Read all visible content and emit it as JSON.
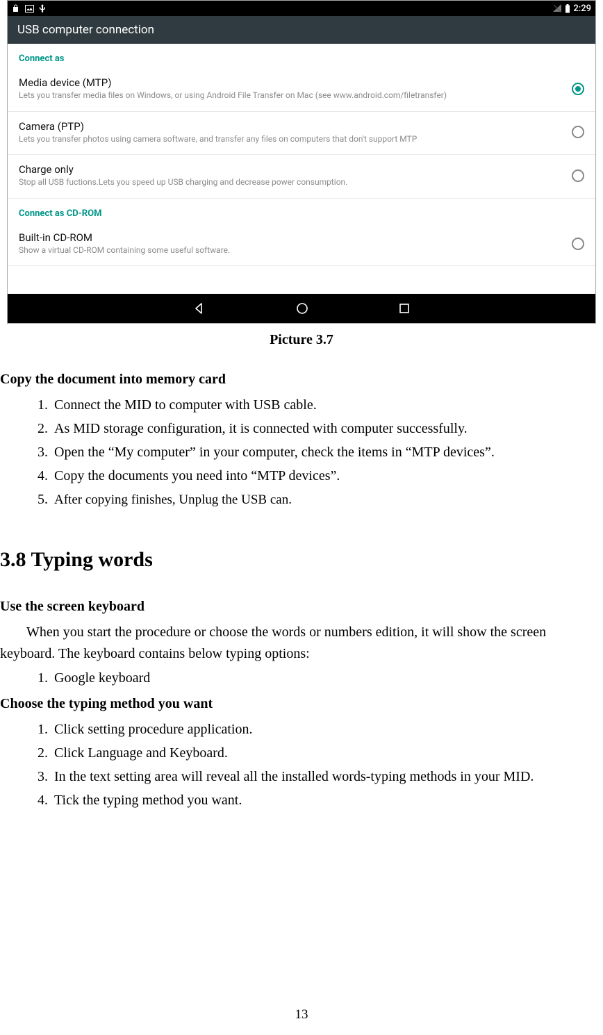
{
  "screenshot": {
    "statusbar": {
      "time": "2:29"
    },
    "title": "USB computer connection",
    "section1": "Connect as",
    "options": [
      {
        "title": "Media device (MTP)",
        "sub": "Lets you transfer media files on Windows, or using Android File Transfer on Mac (see www.android.com/filetransfer)",
        "selected": true
      },
      {
        "title": "Camera (PTP)",
        "sub": "Lets you transfer photos using camera software, and transfer any files on computers that don't support MTP",
        "selected": false
      },
      {
        "title": "Charge only",
        "sub": "Stop all USB fuctions.Lets you speed up USB charging and decrease power consumption.",
        "selected": false
      }
    ],
    "section2": "Connect as CD-ROM",
    "option_cd": {
      "title": "Built-in CD-ROM",
      "sub": "Show a virtual CD-ROM containing some useful software.",
      "selected": false
    }
  },
  "caption": "Picture 3.7",
  "copy_section": {
    "heading": "Copy the document into memory card",
    "items": [
      "Connect the MID to computer with USB cable.",
      "As MID storage configuration, it is connected with computer successfully.",
      "Open the “My computer” in your computer, check the items in “MTP devices”.",
      "Copy the documents you need into “MTP devices”.",
      "After copying finishes, Unplug the USB can."
    ]
  },
  "typing_section": {
    "heading": "3.8 Typing words",
    "sub1": "Use the screen keyboard",
    "para": "When you start the procedure or choose the words or numbers edition, it will show the screen keyboard. The keyboard contains below typing options:",
    "kb_items": [
      "Google keyboard"
    ],
    "sub2": "Choose the typing method you want",
    "steps": [
      "Click setting procedure application.",
      "Click Language and Keyboard.",
      "In the text setting area will reveal all the installed words-typing methods in your MID.",
      "Tick the typing method you want."
    ]
  },
  "page_number": "13"
}
